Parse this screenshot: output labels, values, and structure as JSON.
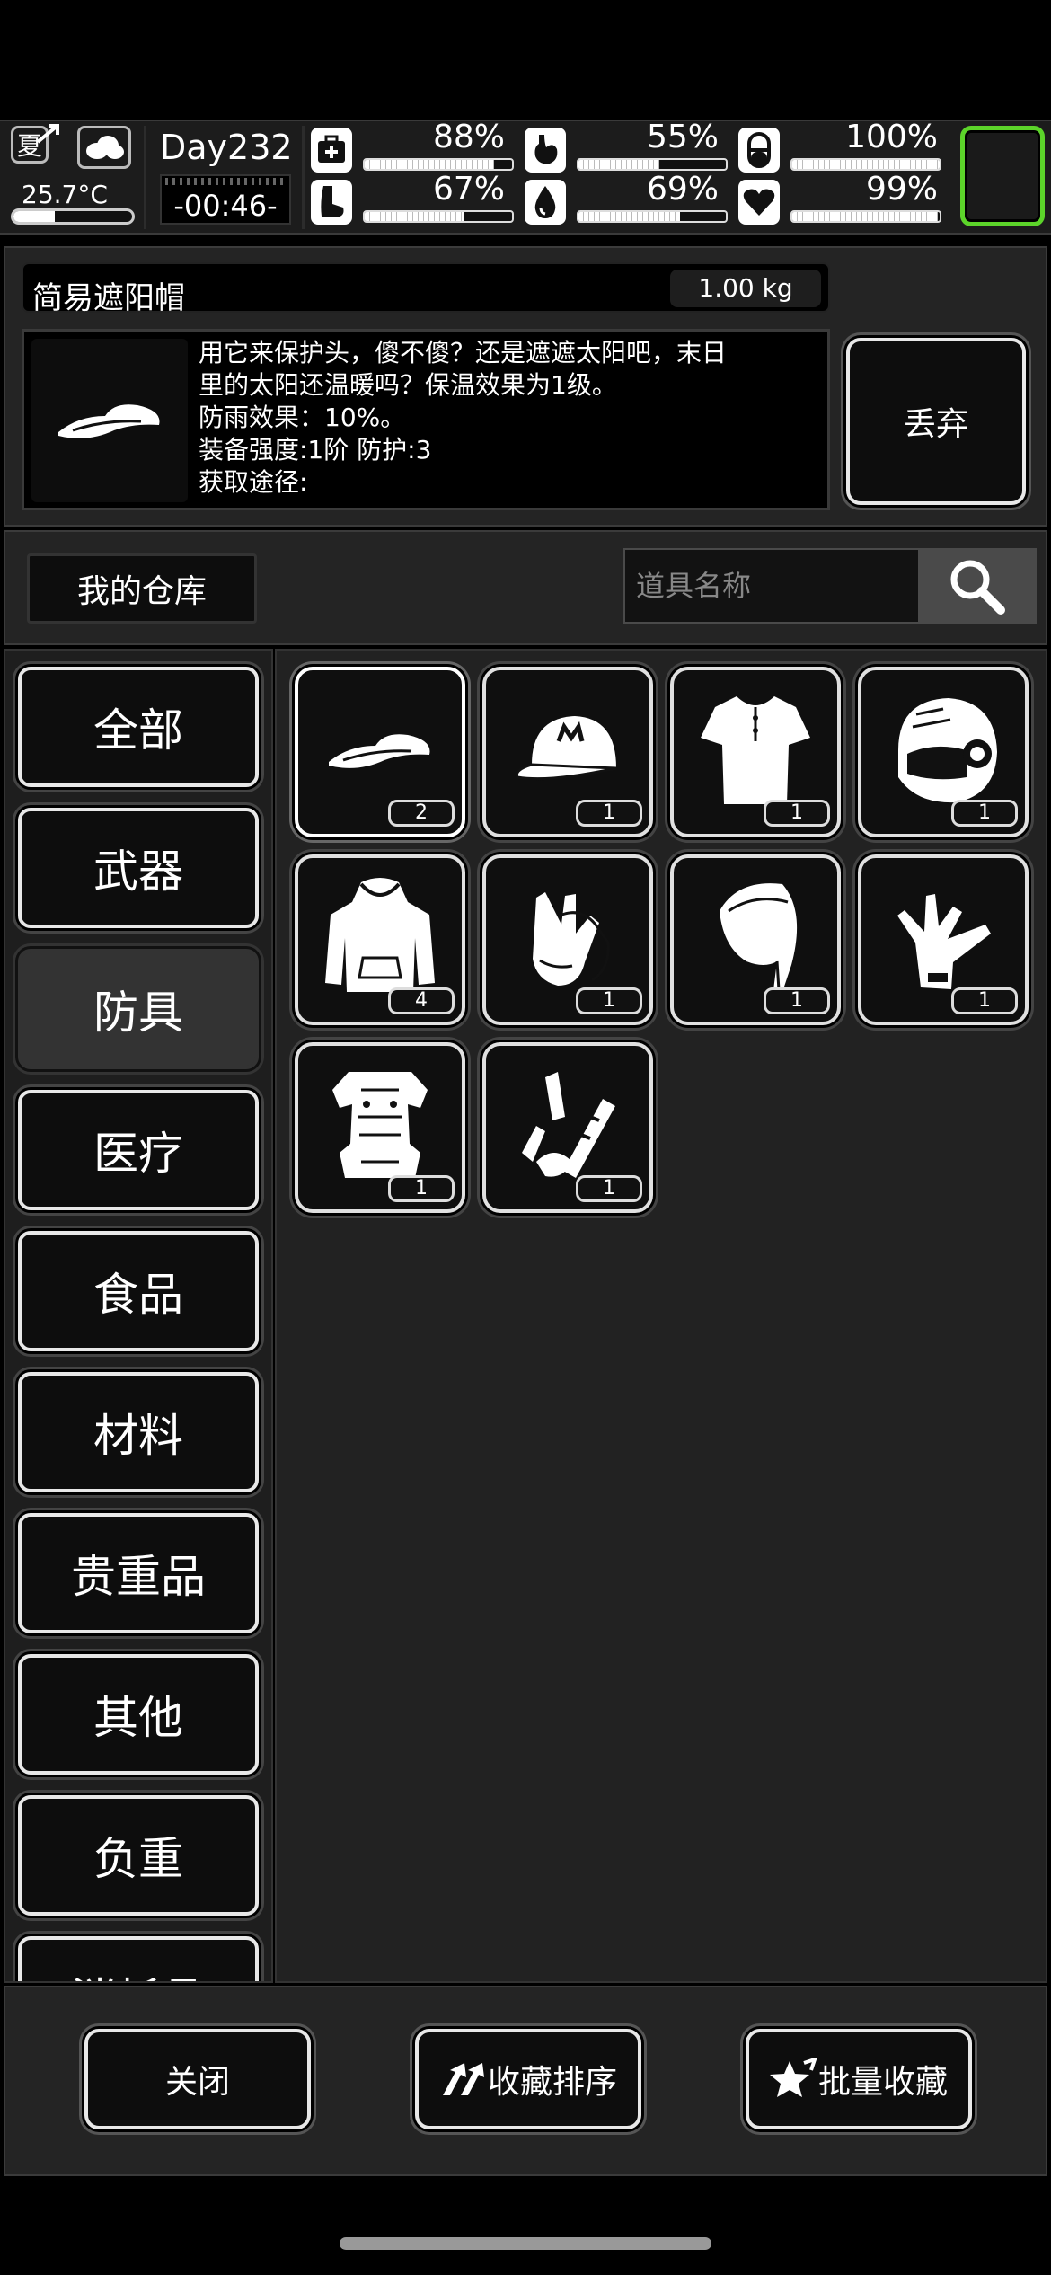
{
  "status": {
    "season": "夏",
    "temperature": "25.7°C",
    "temperature_level": 0.35,
    "day": "Day232",
    "time": "-00:46-",
    "stats": [
      {
        "name": "health",
        "icon": "medkit-icon",
        "pct_label": "88%",
        "value": 0.88
      },
      {
        "name": "hunger",
        "icon": "stomach-icon",
        "pct_label": "55%",
        "value": 0.55
      },
      {
        "name": "energy",
        "icon": "pill-icon",
        "pct_label": "100%",
        "value": 1.0
      },
      {
        "name": "stamina",
        "icon": "foot-icon",
        "pct_label": "67%",
        "value": 0.67
      },
      {
        "name": "thirst",
        "icon": "water-drop-icon",
        "pct_label": "69%",
        "value": 0.69
      },
      {
        "name": "mood",
        "icon": "heart-icon",
        "pct_label": "99%",
        "value": 0.99
      }
    ]
  },
  "item": {
    "name": "简易遮阳帽",
    "weight": "1.00 kg",
    "icon": "visor-icon",
    "description_lines": [
      "用它来保护头，傻不傻？还是遮遮太阳吧，末日",
      "里的太阳还温暖吗？保温效果为1级。",
      "防雨效果：10%。",
      "装备强度:1阶  防护:3",
      "获取途径:"
    ],
    "discard_label": "丢弃"
  },
  "warehouse": {
    "label": "我的仓库",
    "search_placeholder": "道具名称"
  },
  "categories": [
    "全部",
    "武器",
    "防具",
    "医疗",
    "食品",
    "材料",
    "贵重品",
    "其他",
    "负重",
    "消耗品"
  ],
  "active_category": "防具",
  "items": [
    {
      "icon": "visor-icon",
      "count": "2",
      "selected": true
    },
    {
      "icon": "cap-icon",
      "count": "1"
    },
    {
      "icon": "shirt-icon",
      "count": "1"
    },
    {
      "icon": "helmet-icon",
      "count": "1"
    },
    {
      "icon": "hoodie-icon",
      "count": "4"
    },
    {
      "icon": "gloves-icon",
      "count": "1"
    },
    {
      "icon": "hood-icon",
      "count": "1"
    },
    {
      "icon": "glove-icon",
      "count": "1"
    },
    {
      "icon": "body-armor-icon",
      "count": "1"
    },
    {
      "icon": "arm-guard-icon",
      "count": "1"
    }
  ],
  "bottom": {
    "close_label": "关闭",
    "sort_label": "收藏排序",
    "batch_label": "批量收藏"
  }
}
